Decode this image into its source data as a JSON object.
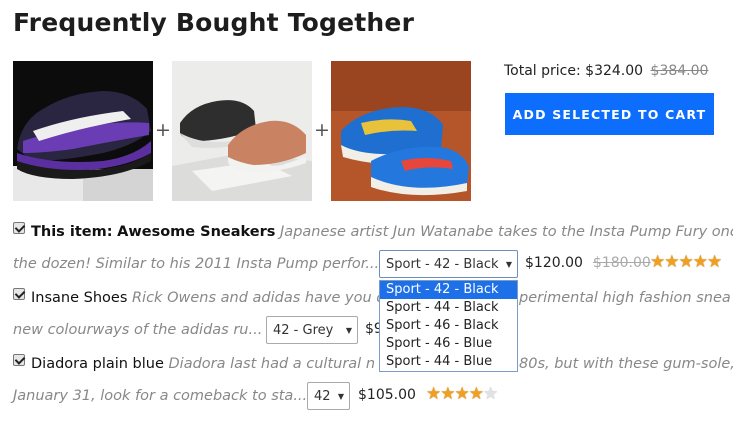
{
  "title": "Frequently Bought Together",
  "images": [
    {
      "icon": "purple-sneaker-photo"
    },
    {
      "icon": "leather-shoes-photo"
    },
    {
      "icon": "blue-sneakers-photo"
    }
  ],
  "plus": "+",
  "total": {
    "label": "Total price:",
    "price": "$324.00",
    "old_price": "$384.00"
  },
  "cart_button": "ADD SELECTED TO CART",
  "items": [
    {
      "prefix": "This item:",
      "name": "Awesome Sneakers",
      "desc_line1": "Japanese artist Jun Watanabe takes to the Insta Pump Fury once",
      "desc_line2": "the dozen! Similar to his 2011 Insta Pump perfor...",
      "selected": "Sport - 42 - Black",
      "price": "$120.00",
      "old_price": "$180.00",
      "rating": 5
    },
    {
      "name": "Insane Shoes",
      "desc_line1a": "Rick Owens and adidas have you c",
      "desc_line1b": "perimental high fashion snea",
      "desc_line2": "new colourways of the adidas ru...",
      "selected": "42 - Grey",
      "price_partial": "$9"
    },
    {
      "name": "Diadora plain blue",
      "desc_line1a": "Diadora last had a cultural n",
      "desc_line1b": "80s, but with these gum-sole,",
      "desc_line2": "January 31, look for a comeback to sta...",
      "selected": "42",
      "price": "$105.00",
      "rating": 4
    }
  ],
  "dropdown_options": [
    "Sport - 42 - Black",
    "Sport - 44 - Black",
    "Sport - 46 - Black",
    "Sport - 46 - Blue",
    "Sport - 44 - Blue"
  ],
  "dropdown_selected_index": 0,
  "star_glyph": "★",
  "arrow_glyph": "▼"
}
